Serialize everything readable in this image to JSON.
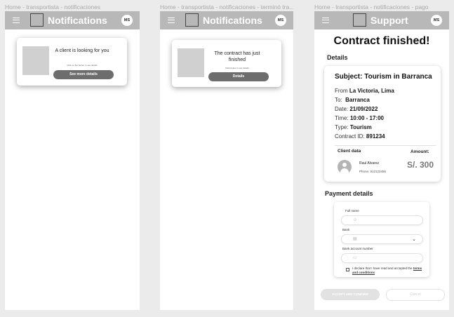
{
  "frames": [
    {
      "title": "Home - transportista - notificaciones",
      "appbar_title": "Notifications",
      "avatar_initials": "MS",
      "card": {
        "message": "A client is looking for you",
        "subtext": "Click on the button to see details",
        "button_label": "See more details"
      }
    },
    {
      "title": "Home - transportista - notificaciones - terminó tra...",
      "appbar_title": "Notifications",
      "avatar_initials": "MS",
      "card": {
        "message": "The contract has just finished",
        "subtext": "Click below to see details",
        "button_label": "Details"
      }
    },
    {
      "title": "Home - transportista - notificaciones - pago",
      "appbar_title": "Support",
      "avatar_initials": "MS",
      "heading": "Contract finished!",
      "details_label": "Details",
      "details": {
        "subject": "Subject: Tourism in Barranca",
        "from_label": "From",
        "from_value": "La Victoria, Lima",
        "to_label": "To:",
        "to_value": "Barranca",
        "date_label": "Date:",
        "date_value": "21/09/2022",
        "time_label": "Time:",
        "time_value": "10:00 - 17:00",
        "type_label": "Type:",
        "type_value": "Tourism",
        "contract_label": "Contract ID:",
        "contract_value": "891234",
        "client_data_label": "Client data",
        "amount_label": "Amount:",
        "client_name": "Raul Alvarez",
        "client_phone": "Phone: 912123456",
        "amount_value": "S/. 300"
      },
      "payment": {
        "label": "Payment details",
        "full_name_label": "Full name",
        "full_name_placeholder": "",
        "bank_label": "Bank",
        "bank_selected": "",
        "account_label": "Bank account number",
        "account_placeholder": "",
        "declare_text": "I declare that I have read and accepted the",
        "terms_link": "terms and conditions",
        "terms_checked": false
      },
      "accept_button": "ACCEPT AND CONFIRM",
      "cancel_button": "Cancel"
    }
  ],
  "colors": {
    "canvas": "#ebebeb",
    "appbar": "#b8b8b8",
    "primary_button": "#6d6d6d",
    "disabled_button": "#e2e2e2"
  },
  "icons": [
    "menu-icon",
    "person-icon",
    "bank-icon",
    "card-icon",
    "chevron-down-icon",
    "user-avatar-icon"
  ]
}
